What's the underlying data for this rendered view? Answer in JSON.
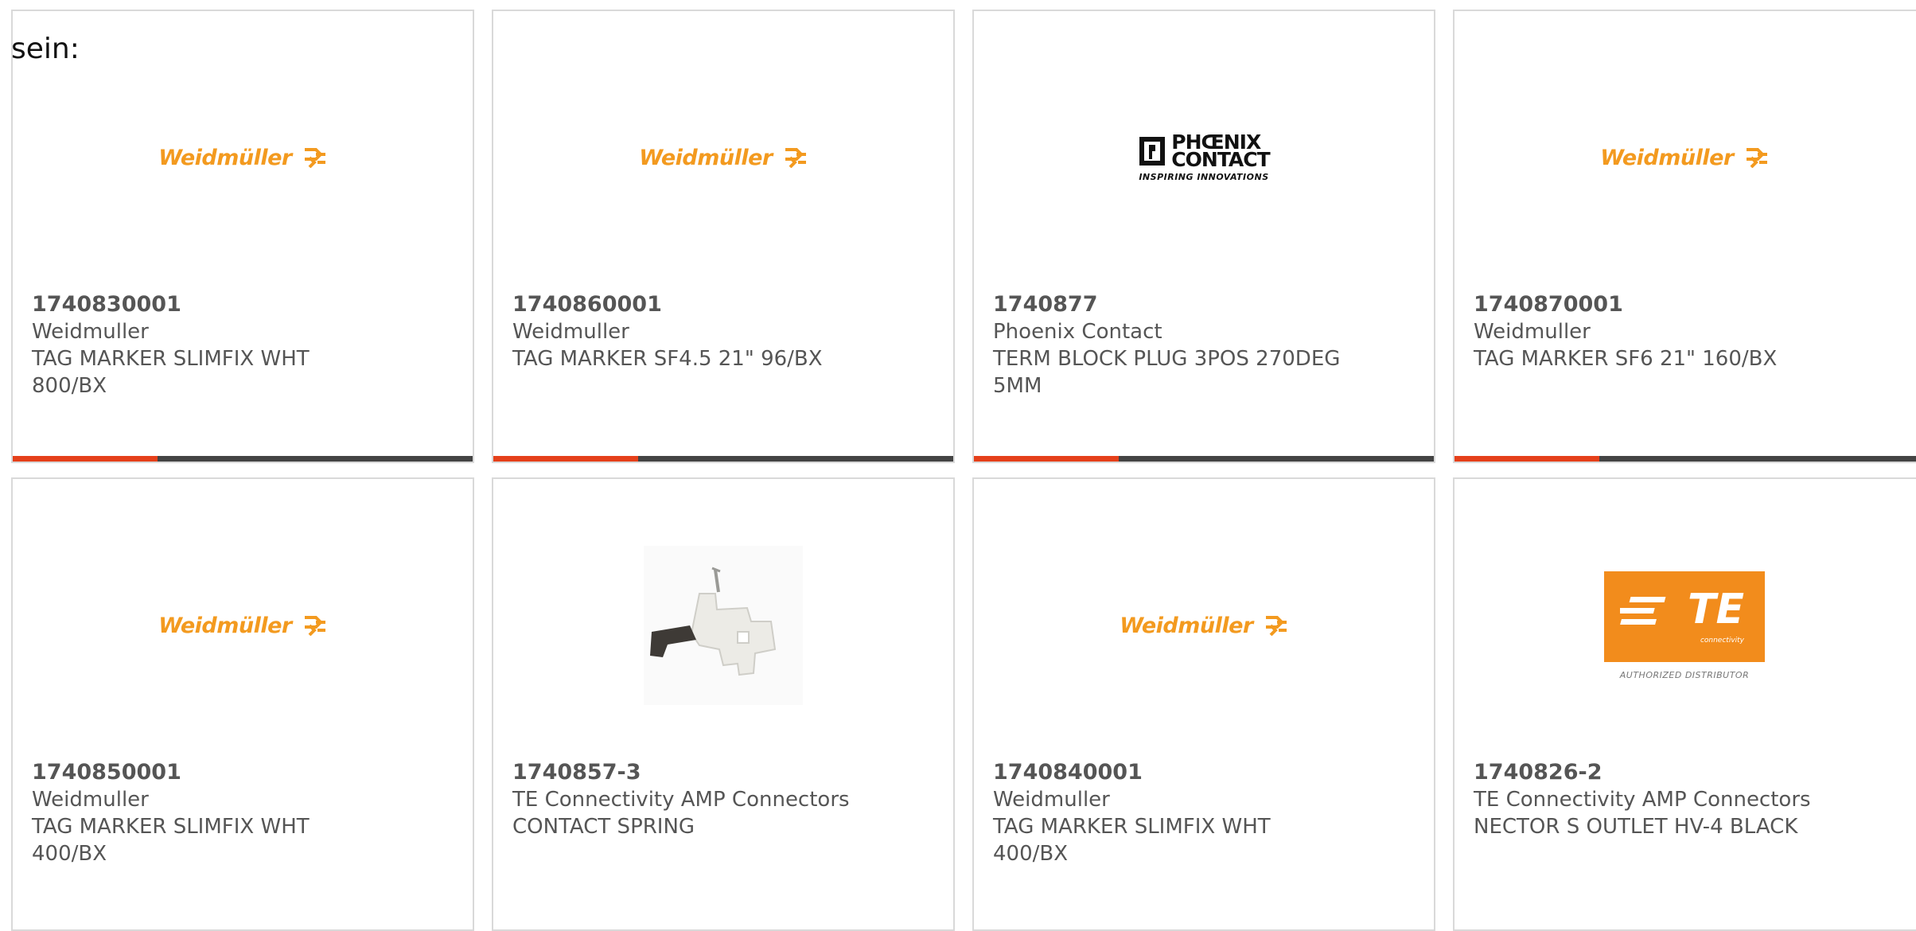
{
  "page_label": "sein:",
  "accent_color": "#e5401a",
  "bar_color": "#444444",
  "cards": [
    {
      "logo": "weidmuller",
      "logo_text": "Weidmüller",
      "part_number": "1740830001",
      "manufacturer": "Weidmuller",
      "description": "TAG MARKER SLIMFIX WHT 800/BX"
    },
    {
      "logo": "weidmuller",
      "logo_text": "Weidmüller",
      "part_number": "1740860001",
      "manufacturer": "Weidmuller",
      "description": "TAG MARKER SF4.5 21\" 96/BX"
    },
    {
      "logo": "phoenix",
      "logo_text_line1": "PHŒNIX",
      "logo_text_line2": "CONTACT",
      "logo_tagline": "INSPIRING INNOVATIONS",
      "part_number": "1740877",
      "manufacturer": "Phoenix Contact",
      "description": "TERM BLOCK PLUG 3POS 270DEG 5MM"
    },
    {
      "logo": "weidmuller",
      "logo_text": "Weidmüller",
      "part_number": "1740870001",
      "manufacturer": "Weidmuller",
      "description": "TAG MARKER SF6 21\" 160/BX"
    },
    {
      "logo": "weidmuller",
      "logo_text": "Weidmüller",
      "part_number": "1740850001",
      "manufacturer": "Weidmuller",
      "description": "TAG MARKER SLIMFIX WHT 400/BX"
    },
    {
      "logo": "product-photo-contact-spring",
      "part_number": "1740857-3",
      "manufacturer": "TE Connectivity AMP Connectors",
      "description": "CONTACT SPRING"
    },
    {
      "logo": "weidmuller",
      "logo_text": "Weidmüller",
      "part_number": "1740840001",
      "manufacturer": "Weidmuller",
      "description": "TAG MARKER SLIMFIX WHT 400/BX"
    },
    {
      "logo": "te",
      "logo_text": "TE",
      "logo_subtext": "connectivity",
      "logo_caption": "AUTHORIZED DISTRIBUTOR",
      "part_number": "1740826-2",
      "manufacturer": "TE Connectivity AMP Connectors",
      "description": "NECTOR S OUTLET HV-4 BLACK"
    }
  ]
}
